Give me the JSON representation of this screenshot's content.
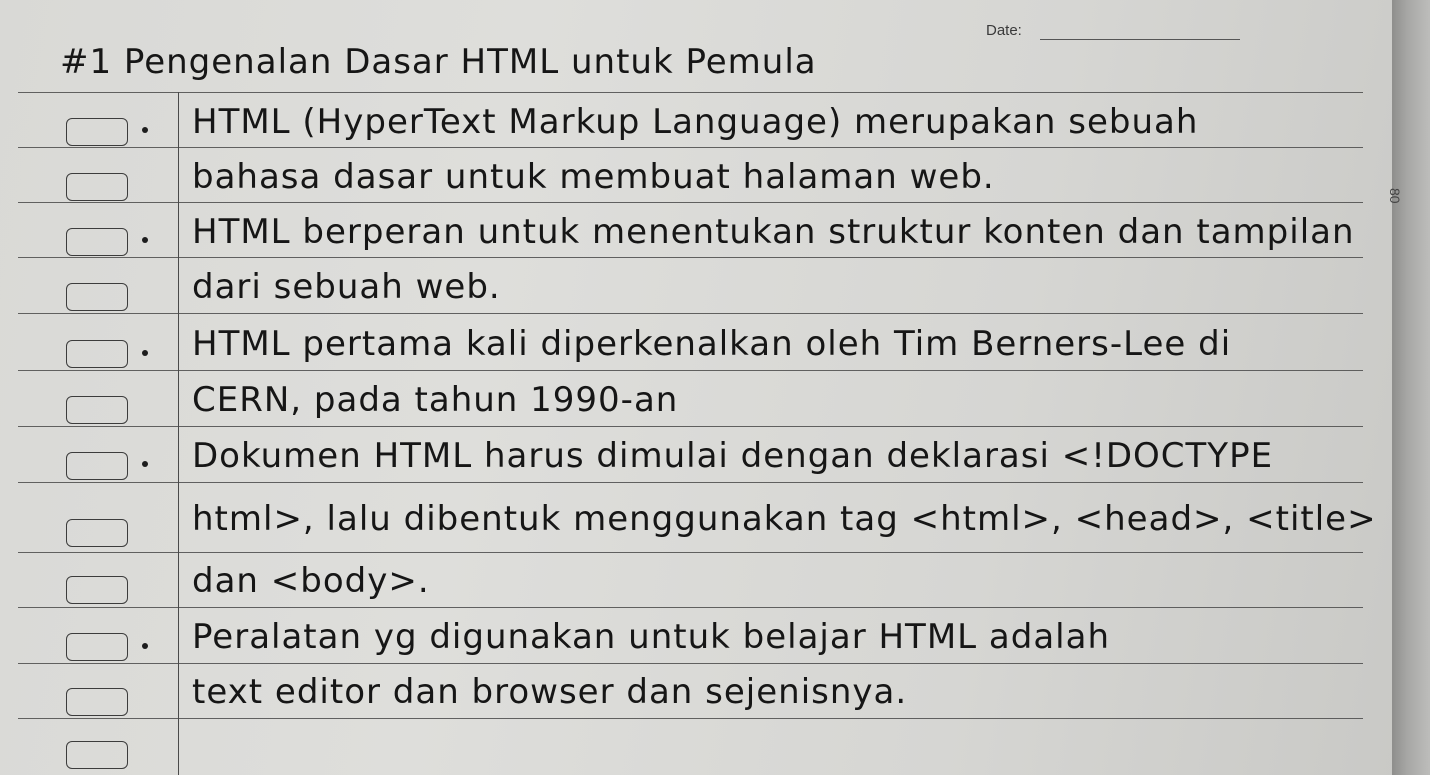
{
  "header": {
    "title": "#1 Pengenalan Dasar HTML untuk Pemula",
    "date_label": "Date:"
  },
  "side_mark": "80",
  "lines": [
    {
      "bullet": true,
      "text": "HTML (HyperText Markup Language) merupakan sebuah"
    },
    {
      "bullet": false,
      "text": "bahasa dasar untuk membuat halaman web."
    },
    {
      "bullet": true,
      "text": "HTML berperan untuk menentukan struktur konten dan tampilan"
    },
    {
      "bullet": false,
      "text": "dari sebuah web."
    },
    {
      "bullet": true,
      "text": "HTML pertama kali diperkenalkan oleh Tim Berners-Lee di"
    },
    {
      "bullet": false,
      "text": "CERN, pada tahun 1990-an"
    },
    {
      "bullet": true,
      "text": "Dokumen HTML harus dimulai dengan deklarasi <!DOCTYPE"
    },
    {
      "bullet": false,
      "text": "html>, lalu dibentuk menggunakan tag <html>, <head>, <title>"
    },
    {
      "bullet": false,
      "text": "dan <body>."
    },
    {
      "bullet": true,
      "text": "Peralatan yg digunakan untuk belajar HTML adalah"
    },
    {
      "bullet": false,
      "text": "text editor dan browser dan sejenisnya."
    },
    {
      "bullet": false,
      "text": ""
    }
  ]
}
